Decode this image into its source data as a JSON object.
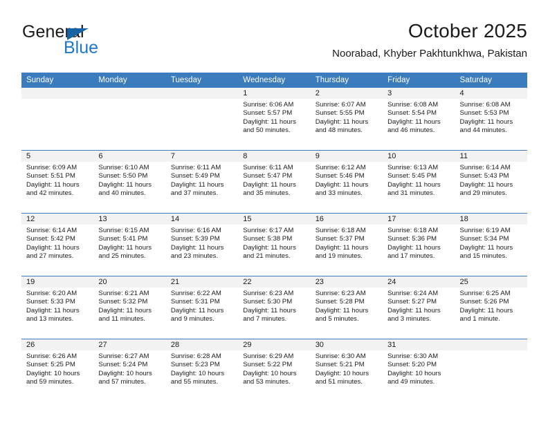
{
  "brand": {
    "name_part1": "General",
    "name_part2": "Blue",
    "triangle_color": "#1464a5",
    "blue_color": "#1e78c8"
  },
  "header": {
    "title": "October 2025",
    "location": "Noorabad, Khyber Pakhtunkhwa, Pakistan"
  },
  "theme": {
    "header_bg": "#3b7cbf",
    "daynum_band_bg": "#f2f2f2",
    "row_divider": "#3b7cbf",
    "text": "#1a1a1a"
  },
  "weekdays": [
    "Sunday",
    "Monday",
    "Tuesday",
    "Wednesday",
    "Thursday",
    "Friday",
    "Saturday"
  ],
  "labels": {
    "sunrise_prefix": "Sunrise:",
    "sunset_prefix": "Sunset:",
    "daylight_prefix": "Daylight:"
  },
  "weeks": [
    [
      {
        "day": "",
        "empty": true
      },
      {
        "day": "",
        "empty": true
      },
      {
        "day": "",
        "empty": true
      },
      {
        "day": "1",
        "sunrise": "Sunrise: 6:06 AM",
        "sunset": "Sunset: 5:57 PM",
        "daylight_l1": "Daylight: 11 hours",
        "daylight_l2": "and 50 minutes."
      },
      {
        "day": "2",
        "sunrise": "Sunrise: 6:07 AM",
        "sunset": "Sunset: 5:55 PM",
        "daylight_l1": "Daylight: 11 hours",
        "daylight_l2": "and 48 minutes."
      },
      {
        "day": "3",
        "sunrise": "Sunrise: 6:08 AM",
        "sunset": "Sunset: 5:54 PM",
        "daylight_l1": "Daylight: 11 hours",
        "daylight_l2": "and 46 minutes."
      },
      {
        "day": "4",
        "sunrise": "Sunrise: 6:08 AM",
        "sunset": "Sunset: 5:53 PM",
        "daylight_l1": "Daylight: 11 hours",
        "daylight_l2": "and 44 minutes."
      }
    ],
    [
      {
        "day": "5",
        "sunrise": "Sunrise: 6:09 AM",
        "sunset": "Sunset: 5:51 PM",
        "daylight_l1": "Daylight: 11 hours",
        "daylight_l2": "and 42 minutes."
      },
      {
        "day": "6",
        "sunrise": "Sunrise: 6:10 AM",
        "sunset": "Sunset: 5:50 PM",
        "daylight_l1": "Daylight: 11 hours",
        "daylight_l2": "and 40 minutes."
      },
      {
        "day": "7",
        "sunrise": "Sunrise: 6:11 AM",
        "sunset": "Sunset: 5:49 PM",
        "daylight_l1": "Daylight: 11 hours",
        "daylight_l2": "and 37 minutes."
      },
      {
        "day": "8",
        "sunrise": "Sunrise: 6:11 AM",
        "sunset": "Sunset: 5:47 PM",
        "daylight_l1": "Daylight: 11 hours",
        "daylight_l2": "and 35 minutes."
      },
      {
        "day": "9",
        "sunrise": "Sunrise: 6:12 AM",
        "sunset": "Sunset: 5:46 PM",
        "daylight_l1": "Daylight: 11 hours",
        "daylight_l2": "and 33 minutes."
      },
      {
        "day": "10",
        "sunrise": "Sunrise: 6:13 AM",
        "sunset": "Sunset: 5:45 PM",
        "daylight_l1": "Daylight: 11 hours",
        "daylight_l2": "and 31 minutes."
      },
      {
        "day": "11",
        "sunrise": "Sunrise: 6:14 AM",
        "sunset": "Sunset: 5:43 PM",
        "daylight_l1": "Daylight: 11 hours",
        "daylight_l2": "and 29 minutes."
      }
    ],
    [
      {
        "day": "12",
        "sunrise": "Sunrise: 6:14 AM",
        "sunset": "Sunset: 5:42 PM",
        "daylight_l1": "Daylight: 11 hours",
        "daylight_l2": "and 27 minutes."
      },
      {
        "day": "13",
        "sunrise": "Sunrise: 6:15 AM",
        "sunset": "Sunset: 5:41 PM",
        "daylight_l1": "Daylight: 11 hours",
        "daylight_l2": "and 25 minutes."
      },
      {
        "day": "14",
        "sunrise": "Sunrise: 6:16 AM",
        "sunset": "Sunset: 5:39 PM",
        "daylight_l1": "Daylight: 11 hours",
        "daylight_l2": "and 23 minutes."
      },
      {
        "day": "15",
        "sunrise": "Sunrise: 6:17 AM",
        "sunset": "Sunset: 5:38 PM",
        "daylight_l1": "Daylight: 11 hours",
        "daylight_l2": "and 21 minutes."
      },
      {
        "day": "16",
        "sunrise": "Sunrise: 6:18 AM",
        "sunset": "Sunset: 5:37 PM",
        "daylight_l1": "Daylight: 11 hours",
        "daylight_l2": "and 19 minutes."
      },
      {
        "day": "17",
        "sunrise": "Sunrise: 6:18 AM",
        "sunset": "Sunset: 5:36 PM",
        "daylight_l1": "Daylight: 11 hours",
        "daylight_l2": "and 17 minutes."
      },
      {
        "day": "18",
        "sunrise": "Sunrise: 6:19 AM",
        "sunset": "Sunset: 5:34 PM",
        "daylight_l1": "Daylight: 11 hours",
        "daylight_l2": "and 15 minutes."
      }
    ],
    [
      {
        "day": "19",
        "sunrise": "Sunrise: 6:20 AM",
        "sunset": "Sunset: 5:33 PM",
        "daylight_l1": "Daylight: 11 hours",
        "daylight_l2": "and 13 minutes."
      },
      {
        "day": "20",
        "sunrise": "Sunrise: 6:21 AM",
        "sunset": "Sunset: 5:32 PM",
        "daylight_l1": "Daylight: 11 hours",
        "daylight_l2": "and 11 minutes."
      },
      {
        "day": "21",
        "sunrise": "Sunrise: 6:22 AM",
        "sunset": "Sunset: 5:31 PM",
        "daylight_l1": "Daylight: 11 hours",
        "daylight_l2": "and 9 minutes."
      },
      {
        "day": "22",
        "sunrise": "Sunrise: 6:23 AM",
        "sunset": "Sunset: 5:30 PM",
        "daylight_l1": "Daylight: 11 hours",
        "daylight_l2": "and 7 minutes."
      },
      {
        "day": "23",
        "sunrise": "Sunrise: 6:23 AM",
        "sunset": "Sunset: 5:28 PM",
        "daylight_l1": "Daylight: 11 hours",
        "daylight_l2": "and 5 minutes."
      },
      {
        "day": "24",
        "sunrise": "Sunrise: 6:24 AM",
        "sunset": "Sunset: 5:27 PM",
        "daylight_l1": "Daylight: 11 hours",
        "daylight_l2": "and 3 minutes."
      },
      {
        "day": "25",
        "sunrise": "Sunrise: 6:25 AM",
        "sunset": "Sunset: 5:26 PM",
        "daylight_l1": "Daylight: 11 hours",
        "daylight_l2": "and 1 minute."
      }
    ],
    [
      {
        "day": "26",
        "sunrise": "Sunrise: 6:26 AM",
        "sunset": "Sunset: 5:25 PM",
        "daylight_l1": "Daylight: 10 hours",
        "daylight_l2": "and 59 minutes."
      },
      {
        "day": "27",
        "sunrise": "Sunrise: 6:27 AM",
        "sunset": "Sunset: 5:24 PM",
        "daylight_l1": "Daylight: 10 hours",
        "daylight_l2": "and 57 minutes."
      },
      {
        "day": "28",
        "sunrise": "Sunrise: 6:28 AM",
        "sunset": "Sunset: 5:23 PM",
        "daylight_l1": "Daylight: 10 hours",
        "daylight_l2": "and 55 minutes."
      },
      {
        "day": "29",
        "sunrise": "Sunrise: 6:29 AM",
        "sunset": "Sunset: 5:22 PM",
        "daylight_l1": "Daylight: 10 hours",
        "daylight_l2": "and 53 minutes."
      },
      {
        "day": "30",
        "sunrise": "Sunrise: 6:30 AM",
        "sunset": "Sunset: 5:21 PM",
        "daylight_l1": "Daylight: 10 hours",
        "daylight_l2": "and 51 minutes."
      },
      {
        "day": "31",
        "sunrise": "Sunrise: 6:30 AM",
        "sunset": "Sunset: 5:20 PM",
        "daylight_l1": "Daylight: 10 hours",
        "daylight_l2": "and 49 minutes."
      },
      {
        "day": "",
        "empty": true
      }
    ]
  ]
}
